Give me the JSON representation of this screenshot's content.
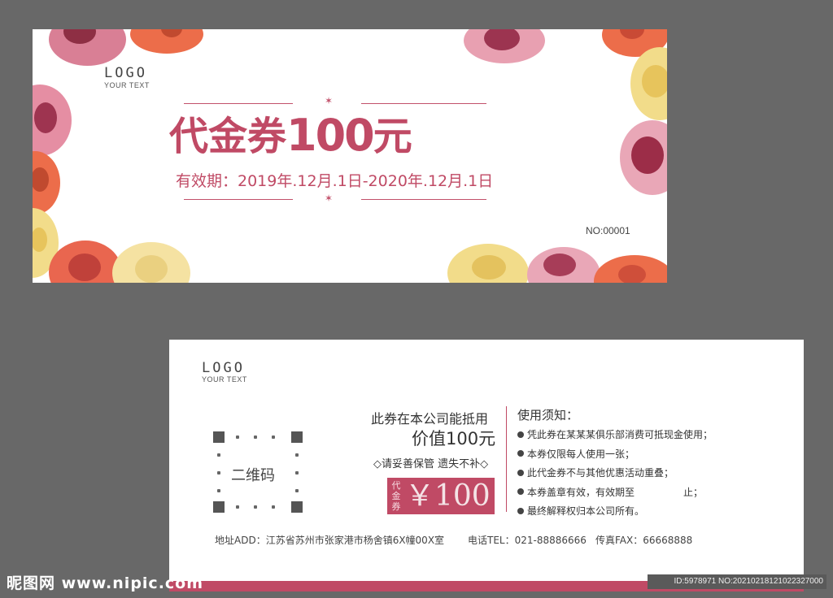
{
  "front": {
    "logo": "LOGO",
    "logo_sub": "YOUR TEXT",
    "title_prefix": "代金券",
    "title_amount": "100",
    "title_suffix": "元",
    "validity": "有效期：2019年.12月.1日-2020年.12月.1日",
    "serial": "NO:00001"
  },
  "back": {
    "logo": "LOGO",
    "logo_sub": "YOUR TEXT",
    "qr_label": "二维码",
    "usable_text": "此券在本公司能抵用",
    "value_text": "价值100元",
    "keep_text": "◇请妥善保管 遗失不补◇",
    "badge_tag": "代金券",
    "badge_value": "￥100",
    "notice_title": "使用须知：",
    "notices": [
      "凭此券在某某某俱乐部消费可抵现金使用；",
      "本券仅限每人使用一张；",
      "此代金券不与其他优惠活动重叠；",
      "本券盖章有效，有效期至　　　　　止；",
      "最终解释权归本公司所有。"
    ],
    "address": "地址ADD：江苏省苏州市张家港市杨舍镇6X幢00X室",
    "phone": "电话TEL：021-88886666",
    "fax": "传真FAX：66668888"
  },
  "watermark": {
    "site": "昵图网 www.nipic.com",
    "id": "ID:5978971 NO:20210218121022327000"
  },
  "colors": {
    "accent": "#c04a65",
    "background": "#686868",
    "card": "#ffffff"
  }
}
